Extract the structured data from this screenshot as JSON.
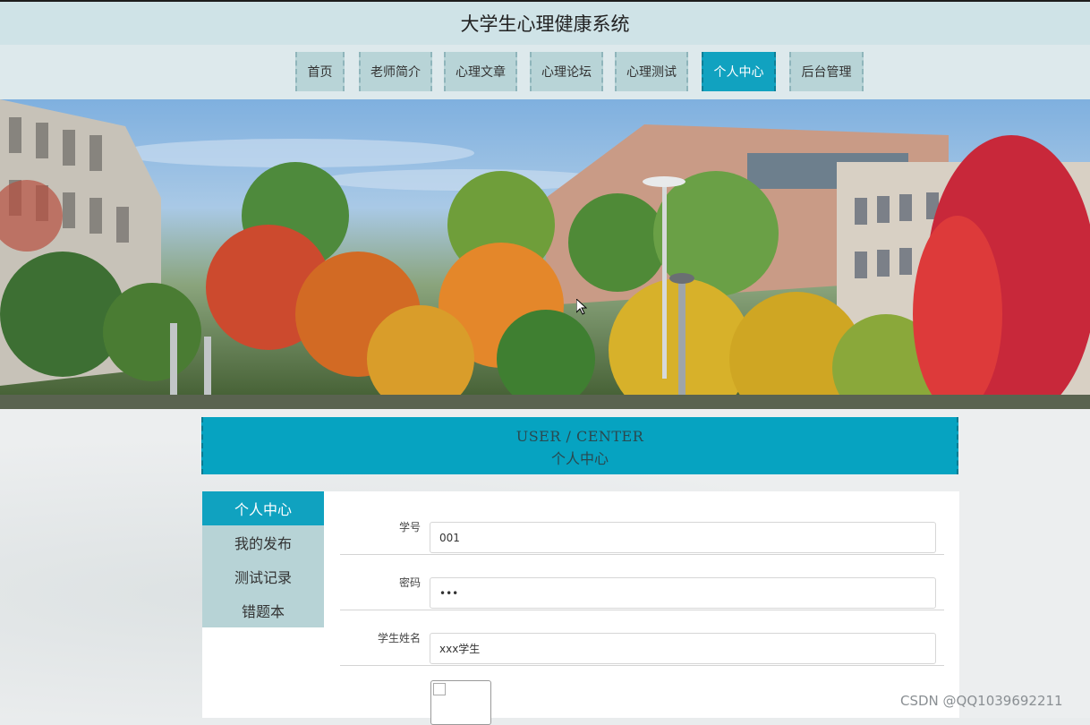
{
  "site": {
    "title": "大学生心理健康系统"
  },
  "nav": {
    "items": [
      {
        "label": "首页",
        "active": false
      },
      {
        "label": "老师简介",
        "active": false
      },
      {
        "label": "心理文章",
        "active": false
      },
      {
        "label": "心理论坛",
        "active": false
      },
      {
        "label": "心理测试",
        "active": false
      },
      {
        "label": "个人中心",
        "active": true
      },
      {
        "label": "后台管理",
        "active": false
      }
    ]
  },
  "center_header": {
    "en": "USER / CENTER",
    "zh": "个人中心"
  },
  "side_menu": {
    "items": [
      {
        "label": "个人中心",
        "active": true
      },
      {
        "label": "我的发布",
        "active": false
      },
      {
        "label": "测试记录",
        "active": false
      },
      {
        "label": "错题本",
        "active": false
      }
    ]
  },
  "form": {
    "student_id": {
      "label": "学号",
      "value": "001"
    },
    "password": {
      "label": "密码",
      "value": "•••"
    },
    "student_name": {
      "label": "学生姓名",
      "value": "xxx学生"
    }
  },
  "watermark": "CSDN @QQ1039692211",
  "colors": {
    "accent": "#10a2c0",
    "nav_bg": "#b8d4d7",
    "title_bg": "#cfe3e7"
  }
}
